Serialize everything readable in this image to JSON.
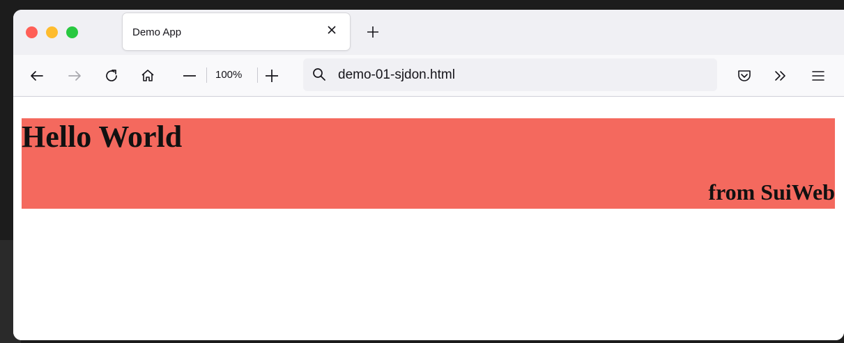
{
  "browser": {
    "tab_title": "Demo App",
    "zoom_level": "100%",
    "url": "demo-01-sjdon.html",
    "icons": [
      "close-icon",
      "plus-icon",
      "back-arrow-icon",
      "forward-arrow-icon",
      "reload-icon",
      "home-icon",
      "zoom-out-icon",
      "zoom-in-icon",
      "search-icon",
      "pocket-icon",
      "more-tools-icon",
      "menu-icon"
    ]
  },
  "page": {
    "heading": "Hello World",
    "subheading": "from SuiWeb",
    "banner_color": "#f4695e"
  },
  "colors": {
    "traffic_red": "#ff5f57",
    "traffic_yellow": "#febc2e",
    "traffic_green": "#28c840"
  }
}
